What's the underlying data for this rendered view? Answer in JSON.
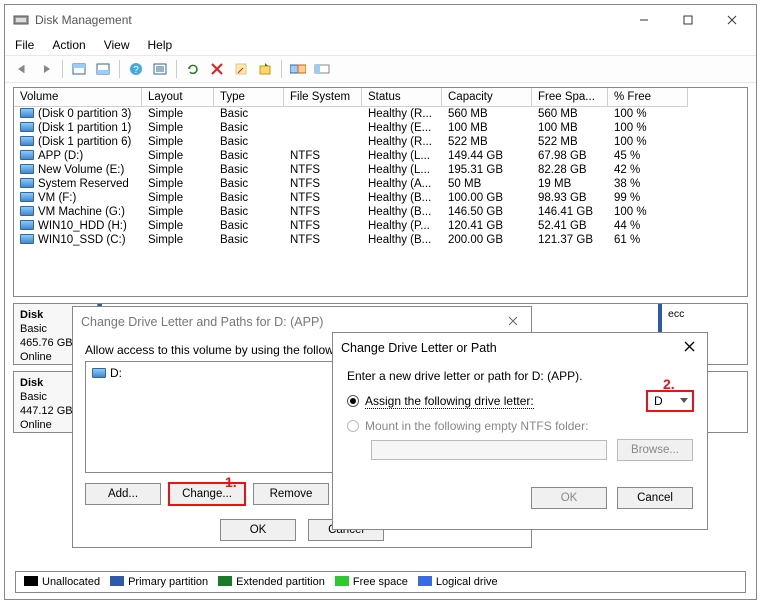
{
  "app": {
    "title": "Disk Management",
    "menus": [
      "File",
      "Action",
      "View",
      "Help"
    ]
  },
  "columns": [
    "Volume",
    "Layout",
    "Type",
    "File System",
    "Status",
    "Capacity",
    "Free Spa...",
    "% Free"
  ],
  "volumes": [
    {
      "name": "(Disk 0 partition 3)",
      "layout": "Simple",
      "type": "Basic",
      "fs": "",
      "status": "Healthy (R...",
      "cap": "560 MB",
      "free": "560 MB",
      "pct": "100 %"
    },
    {
      "name": "(Disk 1 partition 1)",
      "layout": "Simple",
      "type": "Basic",
      "fs": "",
      "status": "Healthy (E...",
      "cap": "100 MB",
      "free": "100 MB",
      "pct": "100 %"
    },
    {
      "name": "(Disk 1 partition 6)",
      "layout": "Simple",
      "type": "Basic",
      "fs": "",
      "status": "Healthy (R...",
      "cap": "522 MB",
      "free": "522 MB",
      "pct": "100 %"
    },
    {
      "name": "APP (D:)",
      "layout": "Simple",
      "type": "Basic",
      "fs": "NTFS",
      "status": "Healthy (L...",
      "cap": "149.44 GB",
      "free": "67.98 GB",
      "pct": "45 %"
    },
    {
      "name": "New Volume (E:)",
      "layout": "Simple",
      "type": "Basic",
      "fs": "NTFS",
      "status": "Healthy (L...",
      "cap": "195.31 GB",
      "free": "82.28 GB",
      "pct": "42 %"
    },
    {
      "name": "System Reserved",
      "layout": "Simple",
      "type": "Basic",
      "fs": "NTFS",
      "status": "Healthy (A...",
      "cap": "50 MB",
      "free": "19 MB",
      "pct": "38 %"
    },
    {
      "name": "VM (F:)",
      "layout": "Simple",
      "type": "Basic",
      "fs": "NTFS",
      "status": "Healthy (B...",
      "cap": "100.00 GB",
      "free": "98.93 GB",
      "pct": "99 %"
    },
    {
      "name": "VM Machine (G:)",
      "layout": "Simple",
      "type": "Basic",
      "fs": "NTFS",
      "status": "Healthy (B...",
      "cap": "146.50 GB",
      "free": "146.41 GB",
      "pct": "100 %"
    },
    {
      "name": "WIN10_HDD (H:)",
      "layout": "Simple",
      "type": "Basic",
      "fs": "NTFS",
      "status": "Healthy (P...",
      "cap": "120.41 GB",
      "free": "52.41 GB",
      "pct": "44 %"
    },
    {
      "name": "WIN10_SSD (C:)",
      "layout": "Simple",
      "type": "Basic",
      "fs": "NTFS",
      "status": "Healthy (B...",
      "cap": "200.00 GB",
      "free": "121.37 GB",
      "pct": "61 %"
    }
  ],
  "disks": [
    {
      "label": "Disk",
      "type": "Basic",
      "size": "465.76 GB",
      "state": "Online"
    },
    {
      "label": "Disk",
      "type": "Basic",
      "size": "447.12 GB",
      "state": "Online"
    }
  ],
  "legend": {
    "unalloc": "Unallocated",
    "primary": "Primary partition",
    "ext": "Extended partition",
    "free": "Free space",
    "logical": "Logical drive"
  },
  "dlg1": {
    "title": "Change Drive Letter and Paths for D: (APP)",
    "desc": "Allow access to this volume by using the following drive",
    "entry": "D:",
    "add": "Add...",
    "change": "Change...",
    "remove": "Remove",
    "ok": "OK",
    "cancel": "Cancel"
  },
  "dlg2": {
    "title": "Change Drive Letter or Path",
    "prompt": "Enter a new drive letter or path for D: (APP).",
    "opt_assign": "Assign the following drive letter:",
    "opt_mount": "Mount in the following empty NTFS folder:",
    "letter": "D",
    "browse": "Browse...",
    "ok": "OK",
    "cancel": "Cancel"
  },
  "anno": {
    "one": "1.",
    "two": "2."
  },
  "fragment_ecc": "ecc"
}
